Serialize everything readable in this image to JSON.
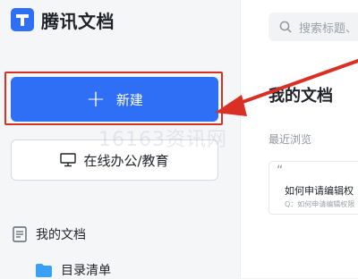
{
  "app": {
    "name": "腾讯文档",
    "logo_icon": "tencent-docs-logo-icon",
    "brand_color": "#2f6ff5"
  },
  "sidebar": {
    "new_button": {
      "icon": "plus-icon",
      "label": "新建"
    },
    "office_button": {
      "icon": "monitor-icon",
      "label": "在线办公/教育"
    },
    "nav": [
      {
        "icon": "document-icon",
        "label": "我的文档"
      },
      {
        "icon": "folder-icon",
        "label": "目录清单"
      }
    ]
  },
  "search": {
    "icon": "search-icon",
    "placeholder": "搜索标题、"
  },
  "main": {
    "title": "我的文档",
    "recent_label": "最近浏览",
    "card": {
      "title": "如何申请编辑权",
      "snippet": "Q：如何申请编辑权限"
    }
  },
  "annotation": {
    "highlight_color": "#d93026"
  },
  "watermark": "16163资讯网"
}
